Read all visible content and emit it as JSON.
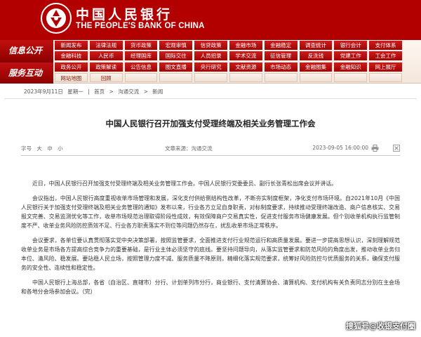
{
  "site": {
    "cn_name": "中国人民银行",
    "en_name": "THE PEOPLE'S BANK OF CHINA"
  },
  "nav": {
    "row1_label": "信息公开",
    "row2_label": "服务互动",
    "rows": [
      [
        "新闻发布",
        "法律法规",
        "货币政策",
        "宏观审慎",
        "信贷政策",
        "金融市场",
        "金融稳定",
        "调查统计",
        "银行会计",
        "支付体系"
      ],
      [
        "金融科技",
        "人民币",
        "经理国库",
        "国际交往",
        "人员招录",
        "学术交流",
        "征信管理",
        "反洗钱",
        "党建工作",
        "工会工作"
      ],
      [
        "政务公开",
        "政策解读",
        "公告信息",
        "图文直播",
        "央行研究",
        "文献资源",
        "市场动态",
        "金融图集",
        "金融知识",
        "网上展厅"
      ],
      [
        "网站地图",
        "回顾",
        "",
        "",
        "",
        "",
        "",
        "",
        "",
        ""
      ]
    ]
  },
  "breadcrumb": {
    "date": "2023年9月11日",
    "weekday": "星期一",
    "home": "首页",
    "section": "沟通交流",
    "page": "新闻"
  },
  "article": {
    "title": "中国人民银行召开加强支付受理终端及相关业务管理工作会",
    "font_size_label": "字号",
    "font_size_large": "大",
    "font_size_medium": "中",
    "font_size_small": "小",
    "source": "文章来源：沟通交流",
    "date": "2023-09-05 16:00:00",
    "paragraphs": [
      "近日，中国人民银行召开加强支付受理终端及相关业务管理工作会。中国人民银行党委委员、副行长张青松出席会议并讲话。",
      "会议指出，中国人民银行高度重视收单市场管理和发展，深化支付供给侧结构性改革，不断夯实制度框架，净化支付市场环境。自2021年10月《中国人民银行关于加强支付受理终端及相关业务管理的通知》发布以来，行业各方立足自身职责，对标制度要求，持续推动受理终端改造、商户信息核实、交易报文完善、交易监测优化等工作，收单市场规范治理取得阶段性成效，有效保障商户交易真实性，促进支付服务市场健康发展。但个别收单机构执行监管制度不严、收单业务风险防控质效不足、行业各方职责落实不到位等问题仍然存在，扰乱收单市场正常秩序。",
      "会议要求，各单位要认真贯彻落实党中央决策部署，按照监管要求，全面推进支付行业规范运行和高质量发展。要进一步提高思想认识，深刻理解规范收单业务是市场各方提高综合竞争力的重要基础，是行业主体必须坚守的底线。要坚持问题导向，从落实监管要求和防范风险的角度出发，推动收单业务归本位、清风险、稳发展。要站稳人民立场，按照管理力度不减、服务质量不降原则，精细化落实规范要求，统筹好风险防控与优质服务的关系，确保支付服务的安全性、连续性和稳定性。",
      "中国人民银行上海总部，各省（自治区、直辖市）分行、计划单列市分行，商业银行、支付清算协会、清算机构、支付机构有关负责同志分别在主会场和各地分会场参加会议。（完）"
    ]
  },
  "watermark": "搜狐号@收银支付圈",
  "colors": {
    "brand_red": "#b20000"
  }
}
